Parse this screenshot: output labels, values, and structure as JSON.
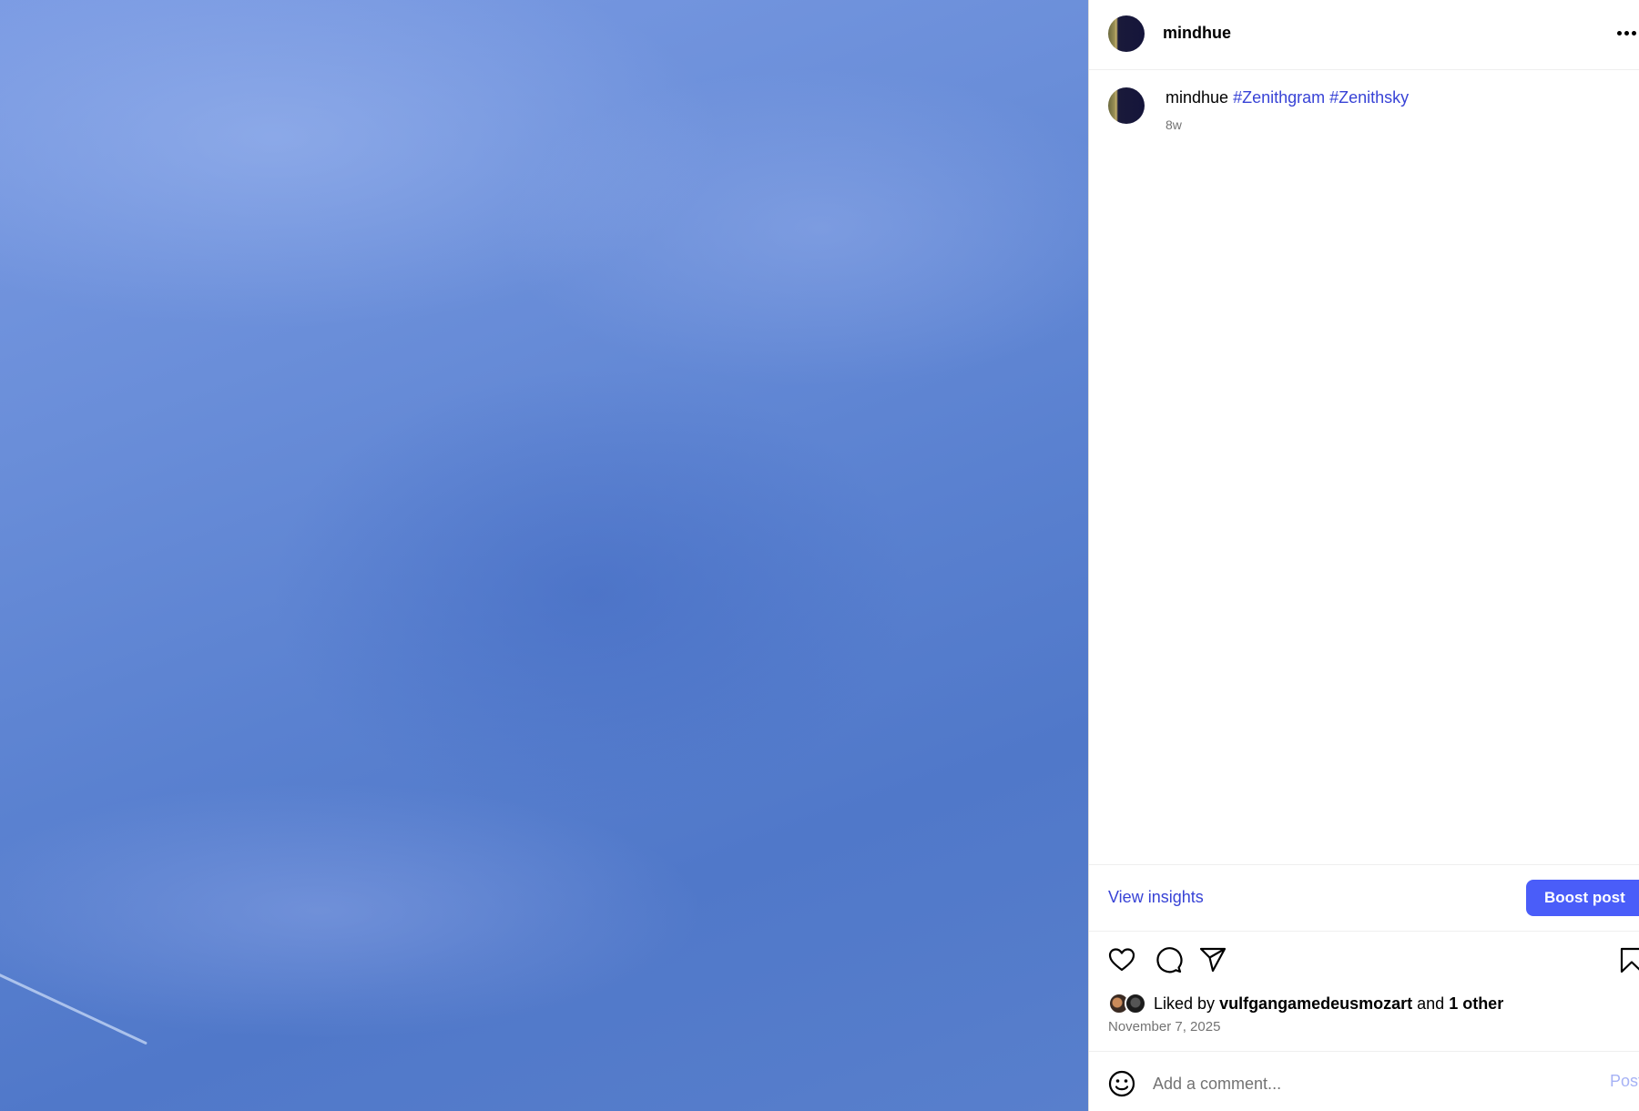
{
  "post": {
    "image_alt": "",
    "author": "mindhue"
  },
  "header": {
    "username": "mindhue",
    "more_icon": "more-horizontal-icon"
  },
  "caption": {
    "username": "mindhue",
    "hashtags": [
      "#Zenithgram",
      "#Zenithsky"
    ],
    "time_ago": "8w"
  },
  "insights": {
    "view_insights_label": "View insights",
    "boost_label": "Boost post"
  },
  "actions": {
    "like_icon": "heart-icon",
    "comment_icon": "comment-icon",
    "share_icon": "send-icon",
    "save_icon": "bookmark-icon"
  },
  "likes": {
    "prefix": "Liked by",
    "user": "vulfgangamedeusmozart",
    "conjunction": "and",
    "others": "1 other"
  },
  "date": "November 7, 2025",
  "comment": {
    "placeholder": "Add a comment...",
    "post_label": "Post"
  },
  "colors": {
    "accent": "#4a5df9",
    "link": "#3843d6",
    "muted": "#737373"
  }
}
